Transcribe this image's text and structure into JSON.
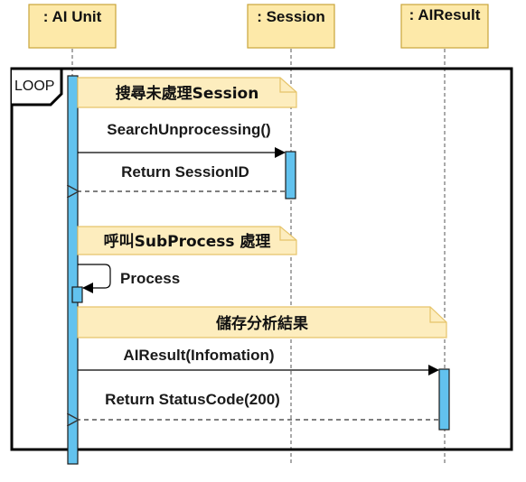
{
  "lifelines": {
    "ai_unit": ": AI Unit",
    "session": ": Session",
    "airesult": ": AIResult"
  },
  "loop": {
    "label": "LOOP"
  },
  "notes": {
    "search_unprocessed": "搜尋未處理Session",
    "call_subprocess": "呼叫SubProcess 處理",
    "store_result": "儲存分析結果"
  },
  "messages": {
    "search_unprocessing": "SearchUnprocessing()",
    "return_session_id": "Return SessionID",
    "process": "Process",
    "airesult_information": "AIResult(Infomation)",
    "return_status_code": "Return StatusCode(200)"
  },
  "colors": {
    "lifeline_box_fill": "#fde9a9",
    "lifeline_box_stroke": "#c9a43a",
    "note_fill": "#fdedbe",
    "note_stroke": "#e6c46a",
    "activation_fill": "#62c2ee",
    "activation_stroke": "#1a1a1a",
    "loop_stroke": "#000000"
  }
}
